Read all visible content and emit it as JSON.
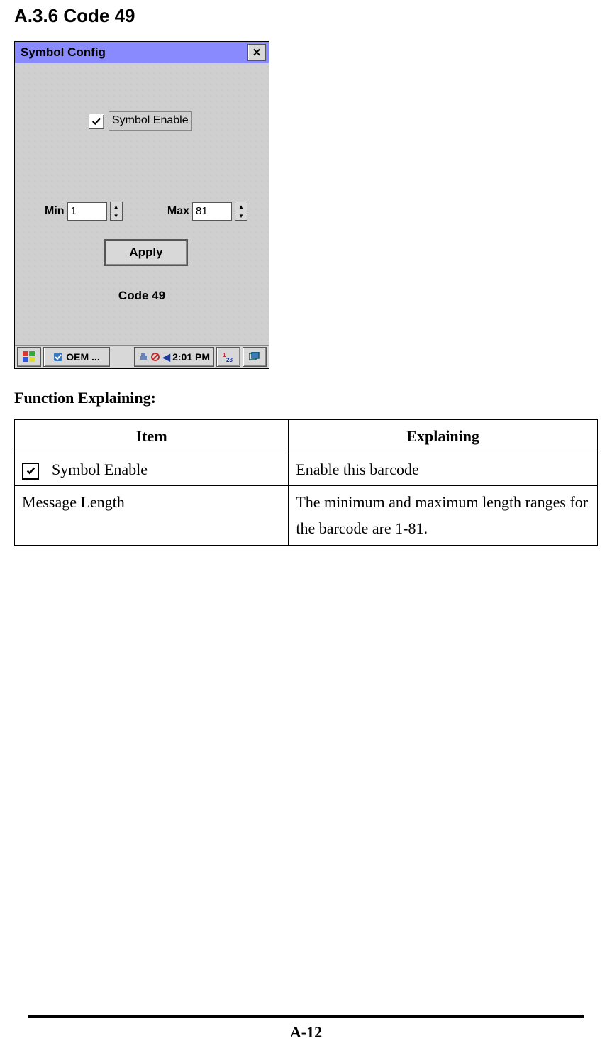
{
  "section_heading": "A.3.6 Code 49",
  "screenshot": {
    "title": "Symbol Config",
    "checkbox_label": "Symbol Enable",
    "checkbox_checked": true,
    "min_label": "Min",
    "min_value": "1",
    "max_label": "Max",
    "max_value": "81",
    "apply_label": "Apply",
    "code_label": "Code 49",
    "taskbar": {
      "app_label": "OEM ...",
      "time": "2:01 PM"
    }
  },
  "function_heading": "Function Explaining:",
  "table": {
    "headers": [
      "Item",
      "Explaining"
    ],
    "rows": [
      {
        "item_has_checkbox": true,
        "item": "Symbol Enable",
        "explain": "Enable this barcode"
      },
      {
        "item_has_checkbox": false,
        "item": "Message Length",
        "explain": "The minimum and maximum length ranges for the barcode are 1-81."
      }
    ]
  },
  "page_number": "A-12"
}
